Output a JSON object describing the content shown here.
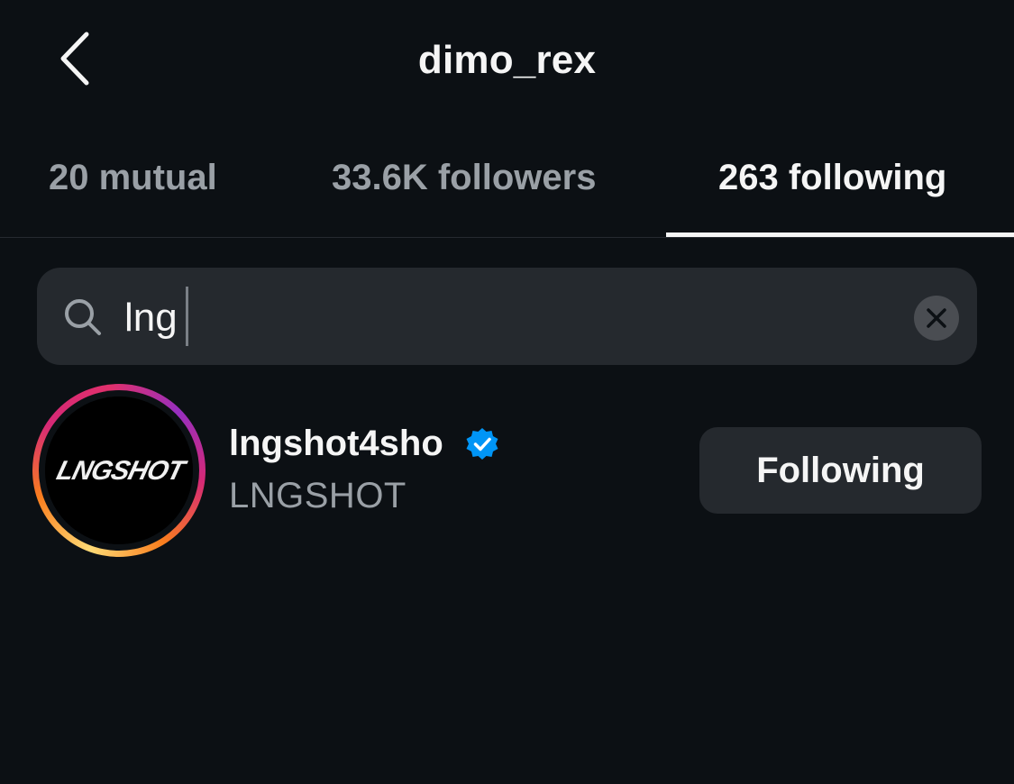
{
  "header": {
    "back_icon": "chevron-left-icon",
    "title": "dimo_rex"
  },
  "tabs": [
    {
      "label": "20 mutual",
      "active": false
    },
    {
      "label": "33.6K followers",
      "active": false
    },
    {
      "label": "263 following",
      "active": true
    }
  ],
  "search": {
    "icon": "search-icon",
    "value": "lng",
    "clear_icon": "clear-icon"
  },
  "results": [
    {
      "username": "lngshot4sho",
      "verified": true,
      "full_name": "LNGSHOT",
      "avatar_text": "LNGSHOT",
      "has_story_ring": true,
      "action_label": "Following"
    }
  ],
  "colors": {
    "background": "#0c1014",
    "surface": "#25292e",
    "text_primary": "#f5f5f5",
    "text_secondary": "#9aa0a6",
    "verified": "#0095f6"
  }
}
